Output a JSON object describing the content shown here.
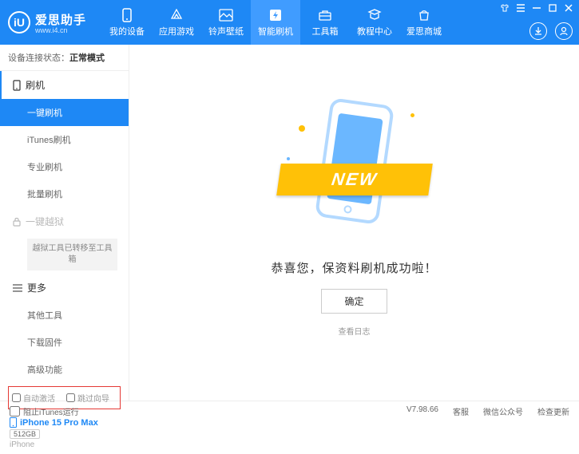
{
  "header": {
    "logo_text": "爱思助手",
    "logo_sub": "www.i4.cn",
    "logo_badge": "iU",
    "nav": [
      {
        "label": "我的设备"
      },
      {
        "label": "应用游戏"
      },
      {
        "label": "铃声壁纸"
      },
      {
        "label": "智能刷机"
      },
      {
        "label": "工具箱"
      },
      {
        "label": "教程中心"
      },
      {
        "label": "爱思商城"
      }
    ]
  },
  "status": {
    "label": "设备连接状态：",
    "value": "正常模式"
  },
  "sidebar": {
    "group1_label": "刷机",
    "items1": [
      {
        "label": "一键刷机"
      },
      {
        "label": "iTunes刷机"
      },
      {
        "label": "专业刷机"
      },
      {
        "label": "批量刷机"
      }
    ],
    "jailbreak_label": "一键越狱",
    "jailbreak_note": "越狱工具已转移至工具箱",
    "group2_label": "更多",
    "items2": [
      {
        "label": "其他工具"
      },
      {
        "label": "下载固件"
      },
      {
        "label": "高级功能"
      }
    ],
    "check1": "自动激活",
    "check2": "跳过向导"
  },
  "device": {
    "name": "iPhone 15 Pro Max",
    "storage": "512GB",
    "type": "iPhone"
  },
  "main": {
    "ribbon": "NEW",
    "message": "恭喜您，保资料刷机成功啦！",
    "ok": "确定",
    "log_link": "查看日志"
  },
  "footer": {
    "block_itunes": "阻止iTunes运行",
    "version": "V7.98.66",
    "links": [
      "客服",
      "微信公众号",
      "检查更新"
    ]
  }
}
